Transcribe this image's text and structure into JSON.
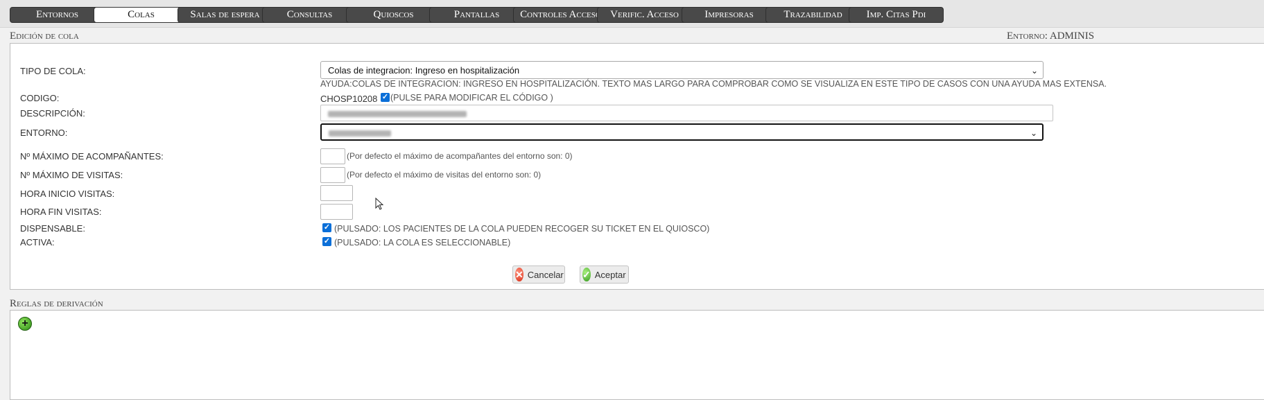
{
  "tabs": [
    {
      "label": "Entornos",
      "active": false
    },
    {
      "label": "Colas",
      "active": true
    },
    {
      "label": "Salas de espera",
      "active": false
    },
    {
      "label": "Consultas",
      "active": false
    },
    {
      "label": "Quioscos",
      "active": false
    },
    {
      "label": "Pantallas",
      "active": false
    },
    {
      "label": "Controles Acceso",
      "active": false
    },
    {
      "label": "Verific. Acceso",
      "active": false
    },
    {
      "label": "Impresoras",
      "active": false
    },
    {
      "label": "Trazabilidad",
      "active": false
    },
    {
      "label": "Imp. Citas Pdi",
      "active": false
    }
  ],
  "edit": {
    "title": "Edición de cola",
    "entorno_header": "Entorno: ADMINIS",
    "tipo_label": "TIPO DE COLA:",
    "tipo_value": "Colas de integracion: Ingreso en hospitalización",
    "tipo_help": "AYUDA:COLAS DE INTEGRACION: INGRESO EN HOSPITALIZACIÓN. TEXTO MAS LARGO PARA COMPROBAR COMO SE VISUALIZA EN ESTE TIPO DE CASOS CON UNA AYUDA MAS EXTENSA.",
    "codigo_label": "CODIGO:",
    "codigo_value": "CHOSP10208",
    "codigo_check_text": "(PULSE PARA MODIFICAR EL CÓDIGO )",
    "codigo_checked": true,
    "descripcion_label": "DESCRIPCIÓN:",
    "entorno_label": "ENTORNO:",
    "max_acomp_label": "Nº MÁXIMO DE ACOMPAÑANTES:",
    "max_acomp_help": "(Por defecto el máximo de acompañantes del entorno son: 0)",
    "max_visitas_label": "Nº MÁXIMO DE VISITAS:",
    "max_visitas_help": "(Por defecto el máximo de visitas del entorno son: 0)",
    "hora_inicio_label": "HORA INICIO VISITAS:",
    "hora_fin_label": "HORA FIN VISITAS:",
    "dispensable_label": "DISPENSABLE:",
    "dispensable_text": "(PULSADO: LOS PACIENTES DE LA COLA PUEDEN RECOGER SU TICKET EN EL QUIOSCO)",
    "dispensable_checked": true,
    "activa_label": "ACTIVA:",
    "activa_text": "(PULSADO: LA COLA ES SELECCIONABLE)",
    "activa_checked": true,
    "cancel_label": "Cancelar",
    "accept_label": "Aceptar"
  },
  "rules": {
    "title": "Reglas de derivación"
  },
  "icons": [
    "chevron-down-icon",
    "checkmark-icon",
    "cancel-icon",
    "accept-icon",
    "add-icon",
    "mouse-cursor-icon"
  ],
  "colors": {
    "tab_bg": "#494949",
    "tab_active_bg": "#ffffff",
    "checkbox": "#0b6fd8"
  }
}
